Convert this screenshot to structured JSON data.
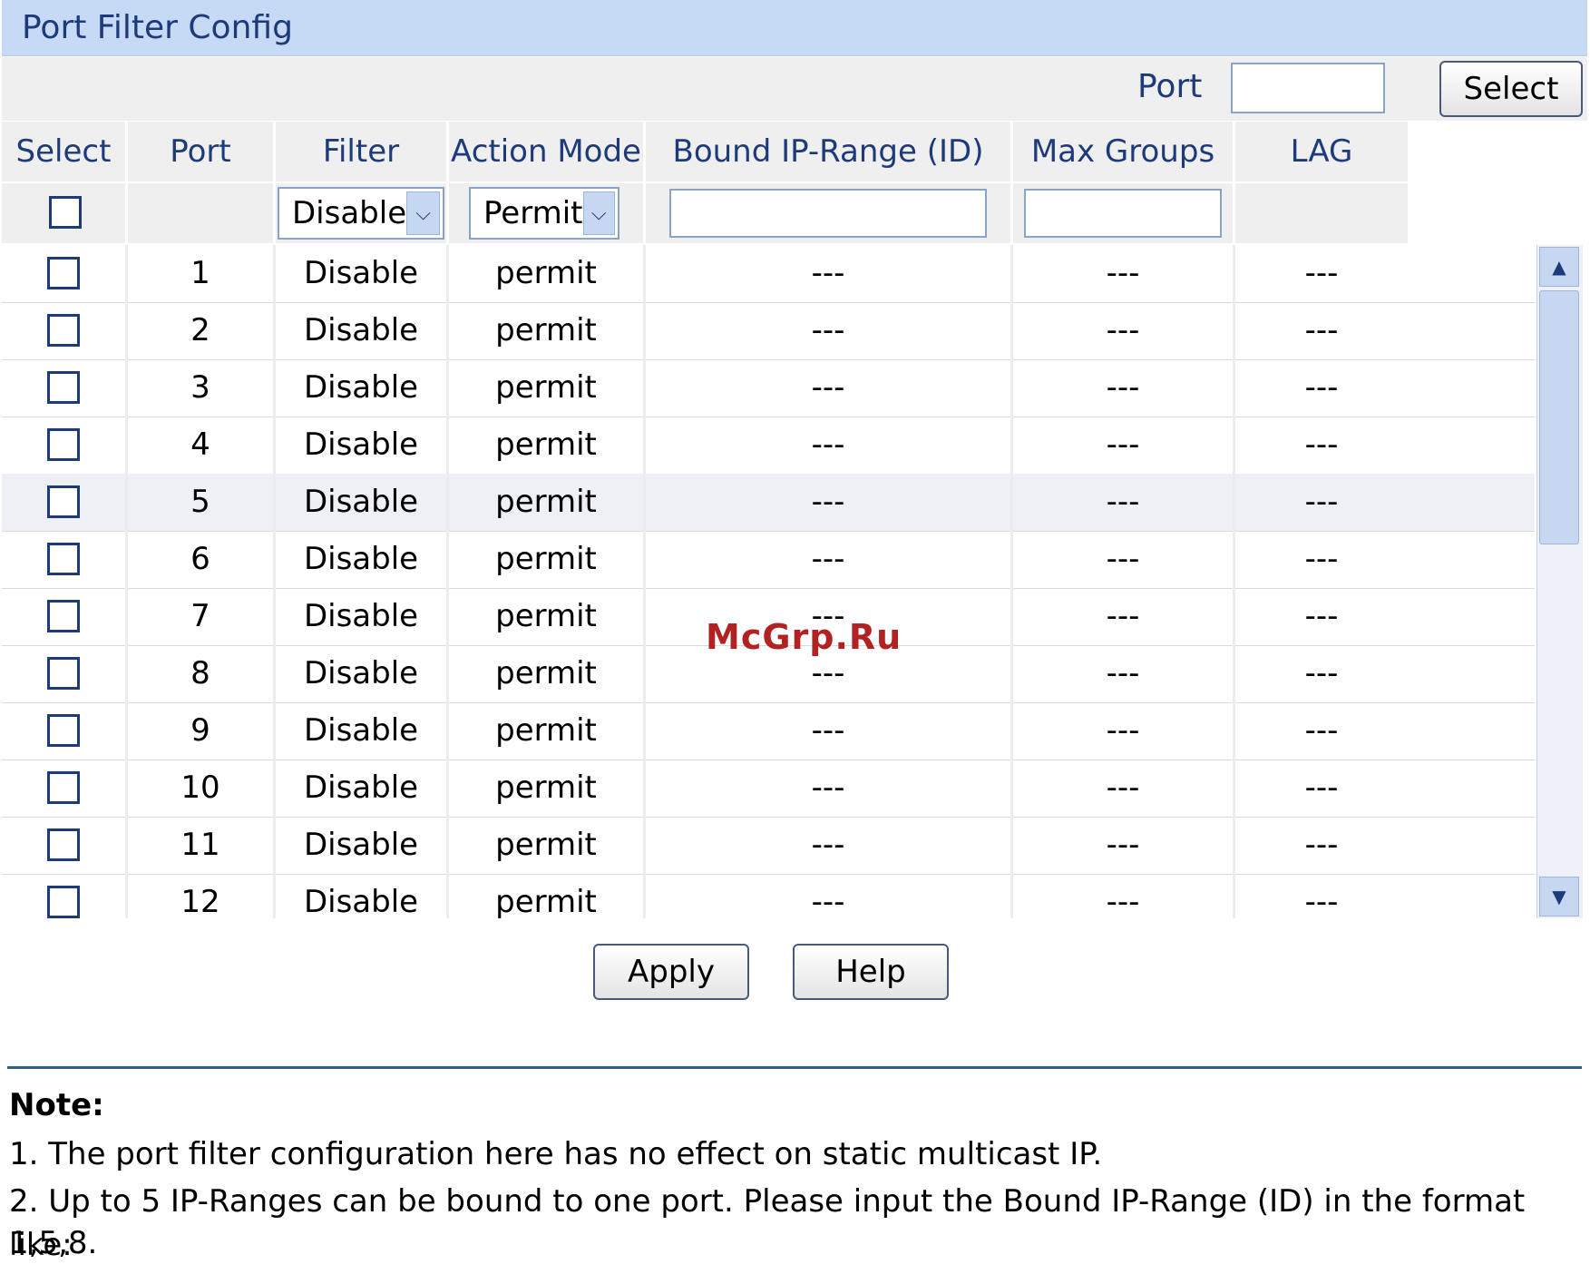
{
  "title": "Port Filter Config",
  "port_select": {
    "label": "Port",
    "value": "",
    "button": "Select"
  },
  "columns": [
    "Select",
    "Port",
    "Filter",
    "Action Mode",
    "Bound IP-Range (ID)",
    "Max Groups",
    "LAG"
  ],
  "edit_row": {
    "filter_value": "Disable",
    "action_value": "Permit",
    "bound_ip_value": "",
    "max_groups_value": ""
  },
  "rows": [
    {
      "port": "1",
      "filter": "Disable",
      "action": "permit",
      "bound": "---",
      "max": "---",
      "lag": "---",
      "highlighted": false
    },
    {
      "port": "2",
      "filter": "Disable",
      "action": "permit",
      "bound": "---",
      "max": "---",
      "lag": "---",
      "highlighted": false
    },
    {
      "port": "3",
      "filter": "Disable",
      "action": "permit",
      "bound": "---",
      "max": "---",
      "lag": "---",
      "highlighted": false
    },
    {
      "port": "4",
      "filter": "Disable",
      "action": "permit",
      "bound": "---",
      "max": "---",
      "lag": "---",
      "highlighted": false
    },
    {
      "port": "5",
      "filter": "Disable",
      "action": "permit",
      "bound": "---",
      "max": "---",
      "lag": "---",
      "highlighted": true
    },
    {
      "port": "6",
      "filter": "Disable",
      "action": "permit",
      "bound": "---",
      "max": "---",
      "lag": "---",
      "highlighted": false
    },
    {
      "port": "7",
      "filter": "Disable",
      "action": "permit",
      "bound": "---",
      "max": "---",
      "lag": "---",
      "highlighted": false
    },
    {
      "port": "8",
      "filter": "Disable",
      "action": "permit",
      "bound": "---",
      "max": "---",
      "lag": "---",
      "highlighted": false
    },
    {
      "port": "9",
      "filter": "Disable",
      "action": "permit",
      "bound": "---",
      "max": "---",
      "lag": "---",
      "highlighted": false
    },
    {
      "port": "10",
      "filter": "Disable",
      "action": "permit",
      "bound": "---",
      "max": "---",
      "lag": "---",
      "highlighted": false
    },
    {
      "port": "11",
      "filter": "Disable",
      "action": "permit",
      "bound": "---",
      "max": "---",
      "lag": "---",
      "highlighted": false
    },
    {
      "port": "12",
      "filter": "Disable",
      "action": "permit",
      "bound": "---",
      "max": "---",
      "lag": "---",
      "highlighted": false
    }
  ],
  "buttons": {
    "apply": "Apply",
    "help": "Help"
  },
  "note": {
    "title": "Note:",
    "line1": "1. The port filter configuration here has no effect on static multicast IP.",
    "line2a": "2. Up to 5 IP-Ranges can be bound to one port. Please input the Bound IP-Range (ID) in the format like:",
    "line2b": "1,5,8."
  },
  "watermark": "McGrp.Ru",
  "icons": {
    "dropdown": "chevron-down-icon",
    "scroll_up": "arrow-up-icon",
    "scroll_down": "arrow-down-icon"
  },
  "colors": {
    "title_bg": "#c6d9f5",
    "header_text": "#1d3a7a",
    "rule": "#2e5f8f"
  }
}
